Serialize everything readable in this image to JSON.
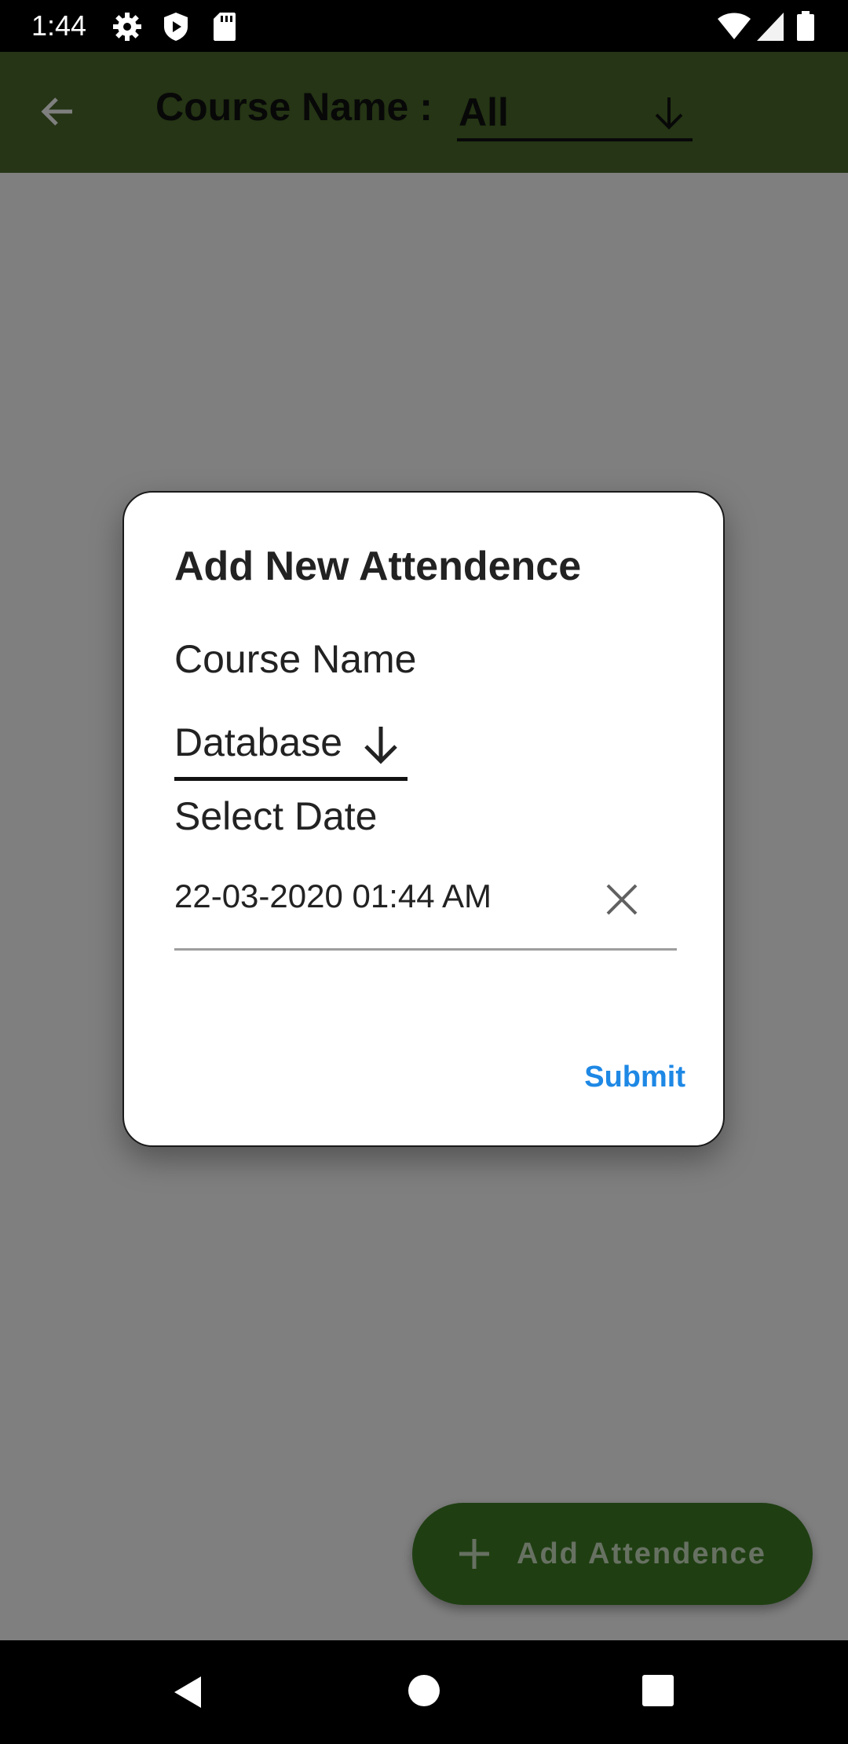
{
  "status_bar": {
    "time": "1:44",
    "left_icons": [
      "settings-icon",
      "shield-icon",
      "sd-card-icon"
    ],
    "right_icons": [
      "wifi-icon",
      "cellular-icon",
      "battery-icon"
    ]
  },
  "app_bar": {
    "color": "#4a6b2a",
    "label": "Course Name :",
    "selected_course": "All"
  },
  "dialog": {
    "title": "Add New Attendence",
    "course_label": "Course Name",
    "course_value": "Database",
    "date_label": "Select Date",
    "date_value": "22-03-2020 01:44 AM",
    "submit_label": "Submit",
    "submit_color": "#1e88e5"
  },
  "fab": {
    "label": "Add Attendence",
    "color": "#3f7e25"
  },
  "nav_bar": {
    "icons": [
      "back-icon",
      "home-icon",
      "recents-icon"
    ]
  }
}
